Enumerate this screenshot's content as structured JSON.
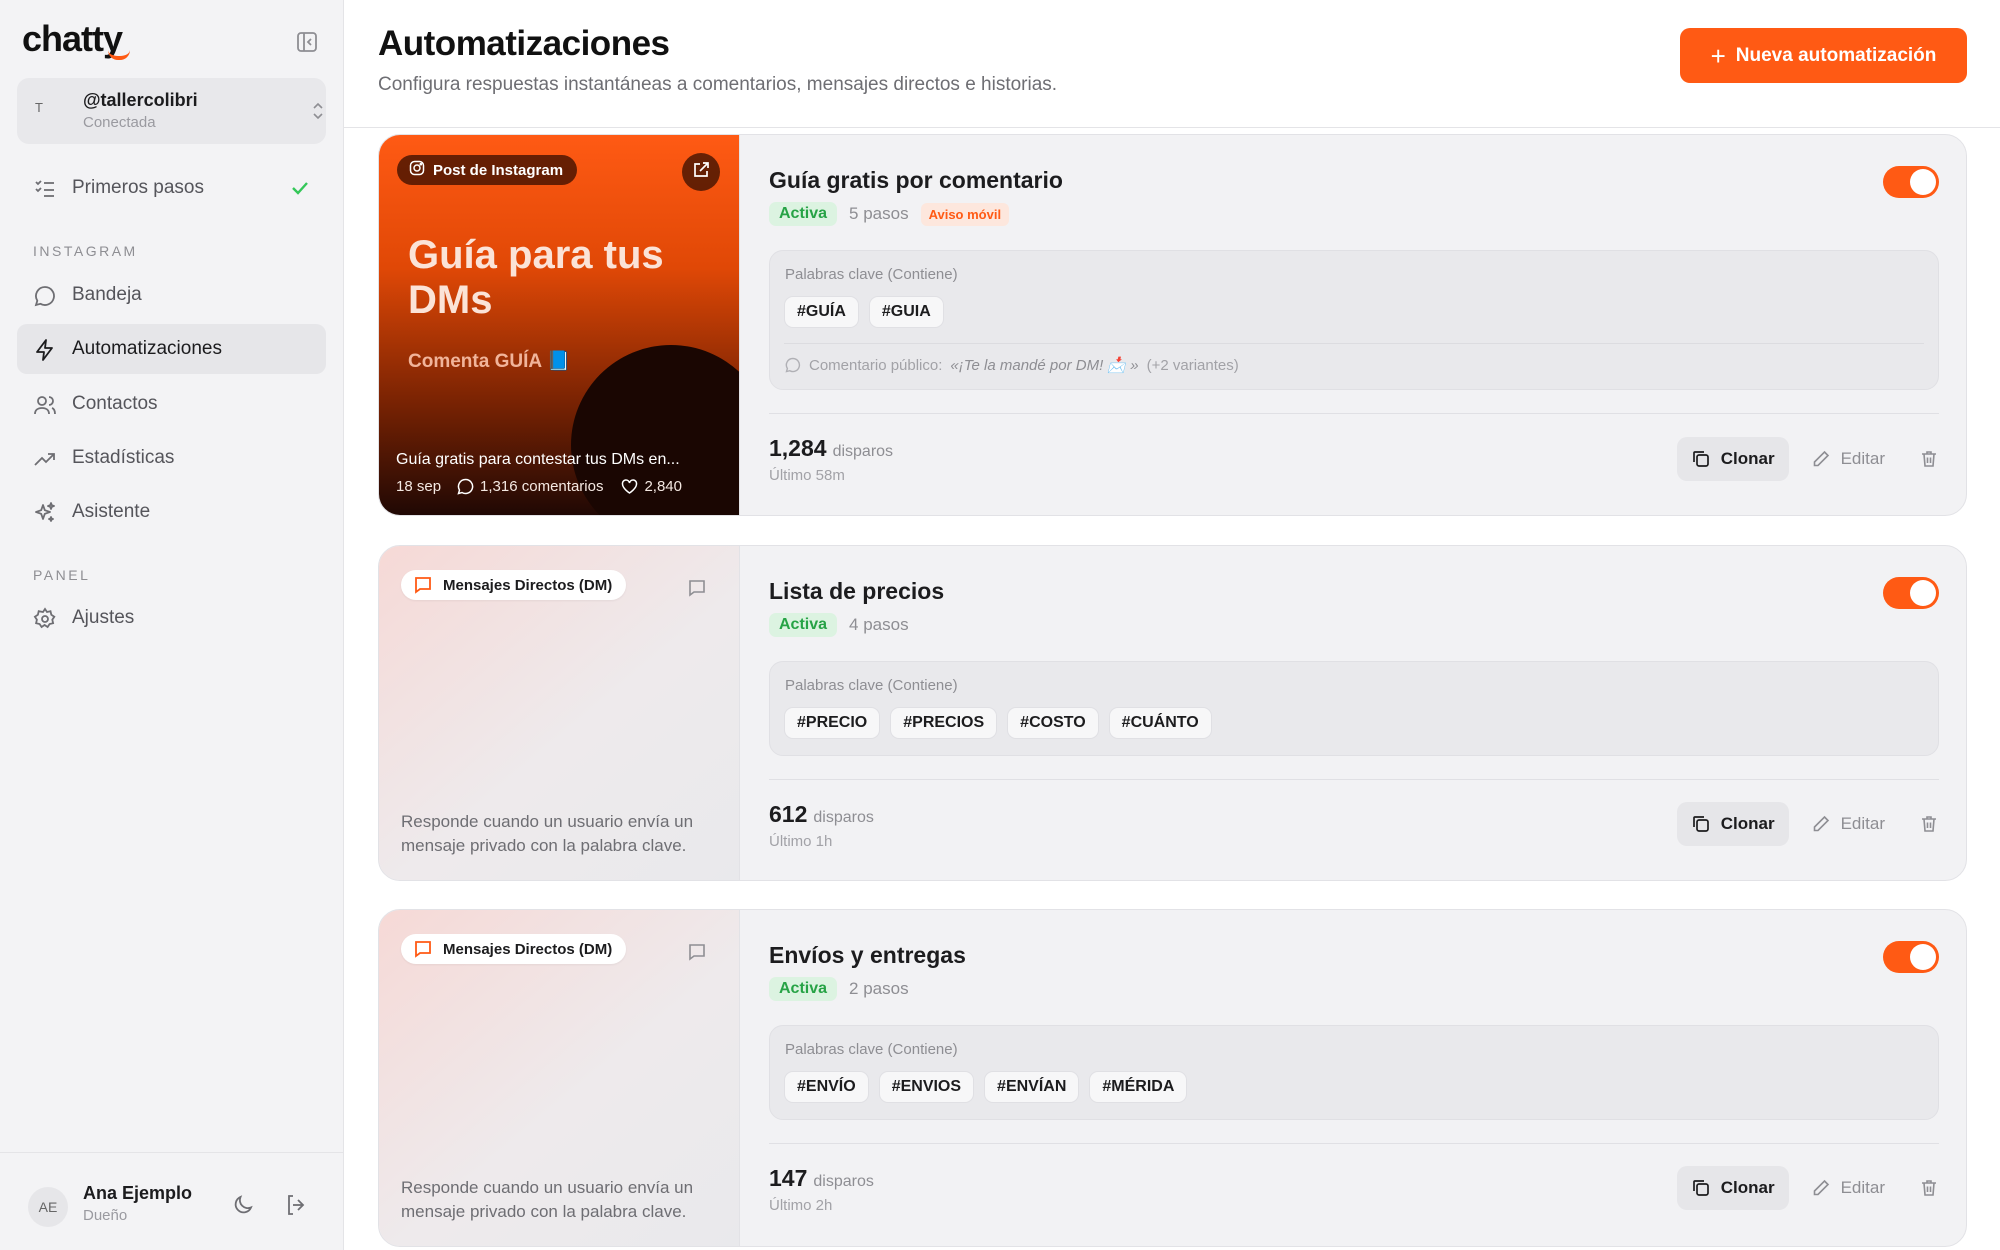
{
  "app": {
    "logo": "chatty"
  },
  "account": {
    "initial": "T",
    "handle": "@tallercolibri",
    "status": "Conectada"
  },
  "sidebar": {
    "getting_started": "Primeros pasos",
    "section_instagram": "INSTAGRAM",
    "section_panel": "PANEL",
    "items": [
      {
        "label": "Bandeja",
        "icon": "chat-bubble-icon"
      },
      {
        "label": "Automatizaciones",
        "icon": "lightning-icon"
      },
      {
        "label": "Contactos",
        "icon": "users-icon"
      },
      {
        "label": "Estadísticas",
        "icon": "trending-icon"
      },
      {
        "label": "Asistente",
        "icon": "sparkles-icon"
      }
    ],
    "settings": "Ajustes"
  },
  "user": {
    "initials": "AE",
    "name": "Ana Ejemplo",
    "role": "Dueño"
  },
  "header": {
    "title": "Automatizaciones",
    "subtitle": "Configura respuestas instantáneas a comentarios, mensajes directos e historias.",
    "new_button": "Nueva automatización"
  },
  "common": {
    "keywords_label": "Palabras clave (Contiene)",
    "fires_unit": "disparos",
    "clone": "Clonar",
    "edit": "Editar",
    "active": "Activa"
  },
  "automations": [
    {
      "thumb": {
        "type_label": "Post de Instagram",
        "headline": "Guía para tus DMs",
        "cta": "Comenta GUÍA 📘",
        "caption": "Guía gratis para contestar tus DMs en...",
        "date": "18 sep",
        "comments": "1,316 comentarios",
        "likes": "2,840"
      },
      "title": "Guía gratis por comentario",
      "steps": "5 pasos",
      "warning": "Aviso móvil",
      "keywords": [
        "#GUÍA",
        "#GUIA"
      ],
      "public_comment_prefix": "Comentario público:",
      "public_comment": "«¡Te la mandé por DM! 📩 »",
      "public_comment_suffix": "(+2 variantes)",
      "fires": "1,284",
      "last": "Último 58m"
    },
    {
      "thumb": {
        "type_label": "Mensajes Directos (DM)",
        "description": "Responde cuando un usuario envía un mensaje privado con la palabra clave."
      },
      "title": "Lista de precios",
      "steps": "4 pasos",
      "keywords": [
        "#PRECIO",
        "#PRECIOS",
        "#COSTO",
        "#CUÁNTO"
      ],
      "fires": "612",
      "last": "Último 1h"
    },
    {
      "thumb": {
        "type_label": "Mensajes Directos (DM)",
        "description": "Responde cuando un usuario envía un mensaje privado con la palabra clave."
      },
      "title": "Envíos y entregas",
      "steps": "2 pasos",
      "keywords": [
        "#ENVÍO",
        "#ENVIOS",
        "#ENVÍAN",
        "#MÉRIDA"
      ],
      "fires": "147",
      "last": "Último 2h"
    }
  ],
  "colors": {
    "accent": "#ff5a14",
    "active_green": "#27a346"
  }
}
